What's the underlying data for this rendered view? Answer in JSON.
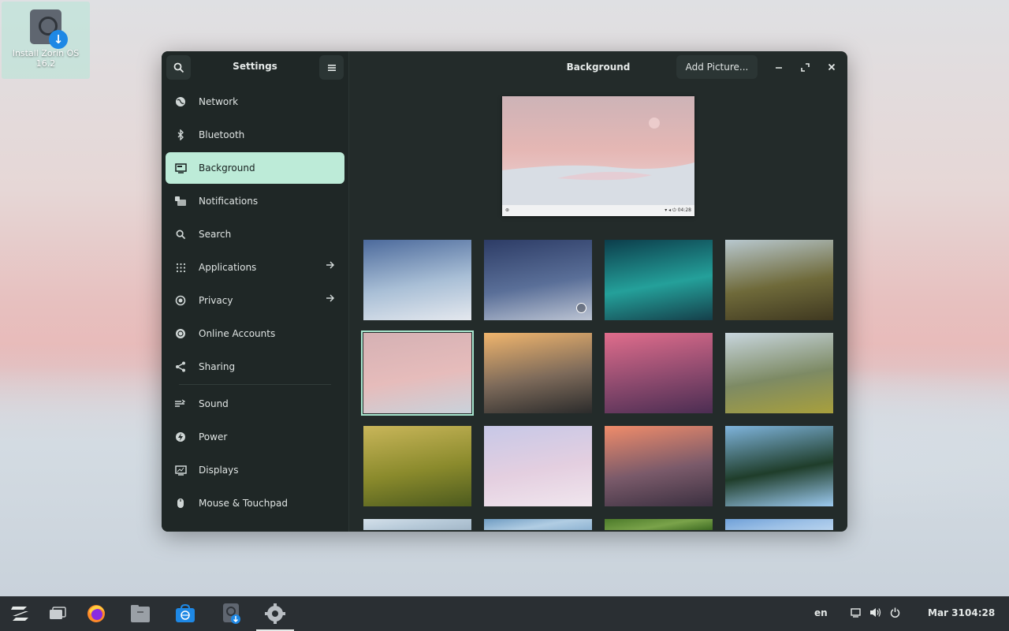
{
  "desktop": {
    "icon_label": "Install Zorin OS 16.2"
  },
  "sidebar": {
    "title": "Settings",
    "items": [
      {
        "label": "Network",
        "icon": "globe-icon"
      },
      {
        "label": "Bluetooth",
        "icon": "bluetooth-icon"
      },
      {
        "label": "Background",
        "icon": "monitor-icon",
        "active": true
      },
      {
        "label": "Notifications",
        "icon": "notification-icon"
      },
      {
        "label": "Search",
        "icon": "search-icon"
      },
      {
        "label": "Applications",
        "icon": "apps-grid-icon",
        "arrow": true
      },
      {
        "label": "Privacy",
        "icon": "privacy-icon",
        "arrow": true
      },
      {
        "label": "Online Accounts",
        "icon": "online-accounts-icon"
      },
      {
        "label": "Sharing",
        "icon": "share-icon"
      },
      {
        "label": "Sound",
        "icon": "sound-icon"
      },
      {
        "label": "Power",
        "icon": "power-icon"
      },
      {
        "label": "Displays",
        "icon": "display-icon"
      },
      {
        "label": "Mouse & Touchpad",
        "icon": "mouse-icon"
      }
    ]
  },
  "main": {
    "title": "Background",
    "add_picture_label": "Add Picture...",
    "preview_clock": "04:28"
  },
  "wallpapers": [
    {
      "name": "mountain-blue",
      "c1": "#4c6a9c",
      "c2": "#a9bfd6",
      "c3": "#e4e8ee"
    },
    {
      "name": "mountain-dark",
      "c1": "#2d3c66",
      "c2": "#5a6f98",
      "c3": "#bcc4d3",
      "current": true
    },
    {
      "name": "aurora",
      "c1": "#0c3d4b",
      "c2": "#24a09a",
      "c3": "#153f4a"
    },
    {
      "name": "canyon",
      "c1": "#b8c8cf",
      "c2": "#6f6a3a",
      "c3": "#3f3820"
    },
    {
      "name": "pink-dunes",
      "c1": "#d5b1b4",
      "c2": "#e6bcbb",
      "c3": "#c9d2db",
      "selected": true
    },
    {
      "name": "sunset-mountains",
      "c1": "#f0b56d",
      "c2": "#7d6a5a",
      "c3": "#2b2b2b"
    },
    {
      "name": "lighthouse",
      "c1": "#e06d8c",
      "c2": "#8d4a6e",
      "c3": "#4b2d52"
    },
    {
      "name": "misty-valley",
      "c1": "#c8d6de",
      "c2": "#7d8a64",
      "c3": "#a8a03c"
    },
    {
      "name": "green-field",
      "c1": "#c9b65a",
      "c2": "#8a8a2c",
      "c3": "#4c5a1e"
    },
    {
      "name": "pastel-clouds",
      "c1": "#c7c8e7",
      "c2": "#e4cfe0",
      "c3": "#f0e6ee"
    },
    {
      "name": "city-sunset",
      "c1": "#f08c6a",
      "c2": "#7a5a6a",
      "c3": "#3b3040"
    },
    {
      "name": "palm-trees",
      "c1": "#7fb4dc",
      "c2": "#1f3d2a",
      "c3": "#9ccaf0"
    },
    {
      "name": "partial-1",
      "c1": "#d4e0ea",
      "c2": "#b6c9d8",
      "c3": "#a3b7c8"
    },
    {
      "name": "partial-2",
      "c1": "#6f9cc2",
      "c2": "#b1cde3",
      "c3": "#8eb3d2"
    },
    {
      "name": "partial-3",
      "c1": "#4c7a2a",
      "c2": "#7aa34a",
      "c3": "#3d6a22"
    },
    {
      "name": "partial-4",
      "c1": "#6fa0d8",
      "c2": "#9cc0e6",
      "c3": "#b8d3ee"
    }
  ],
  "taskbar": {
    "language": "en",
    "date": "Mar 31",
    "time": "04:28",
    "apps": [
      "zorin-menu-icon",
      "workspaces-icon",
      "firefox-icon",
      "files-icon",
      "software-store-icon",
      "installer-icon",
      "settings-icon"
    ]
  }
}
